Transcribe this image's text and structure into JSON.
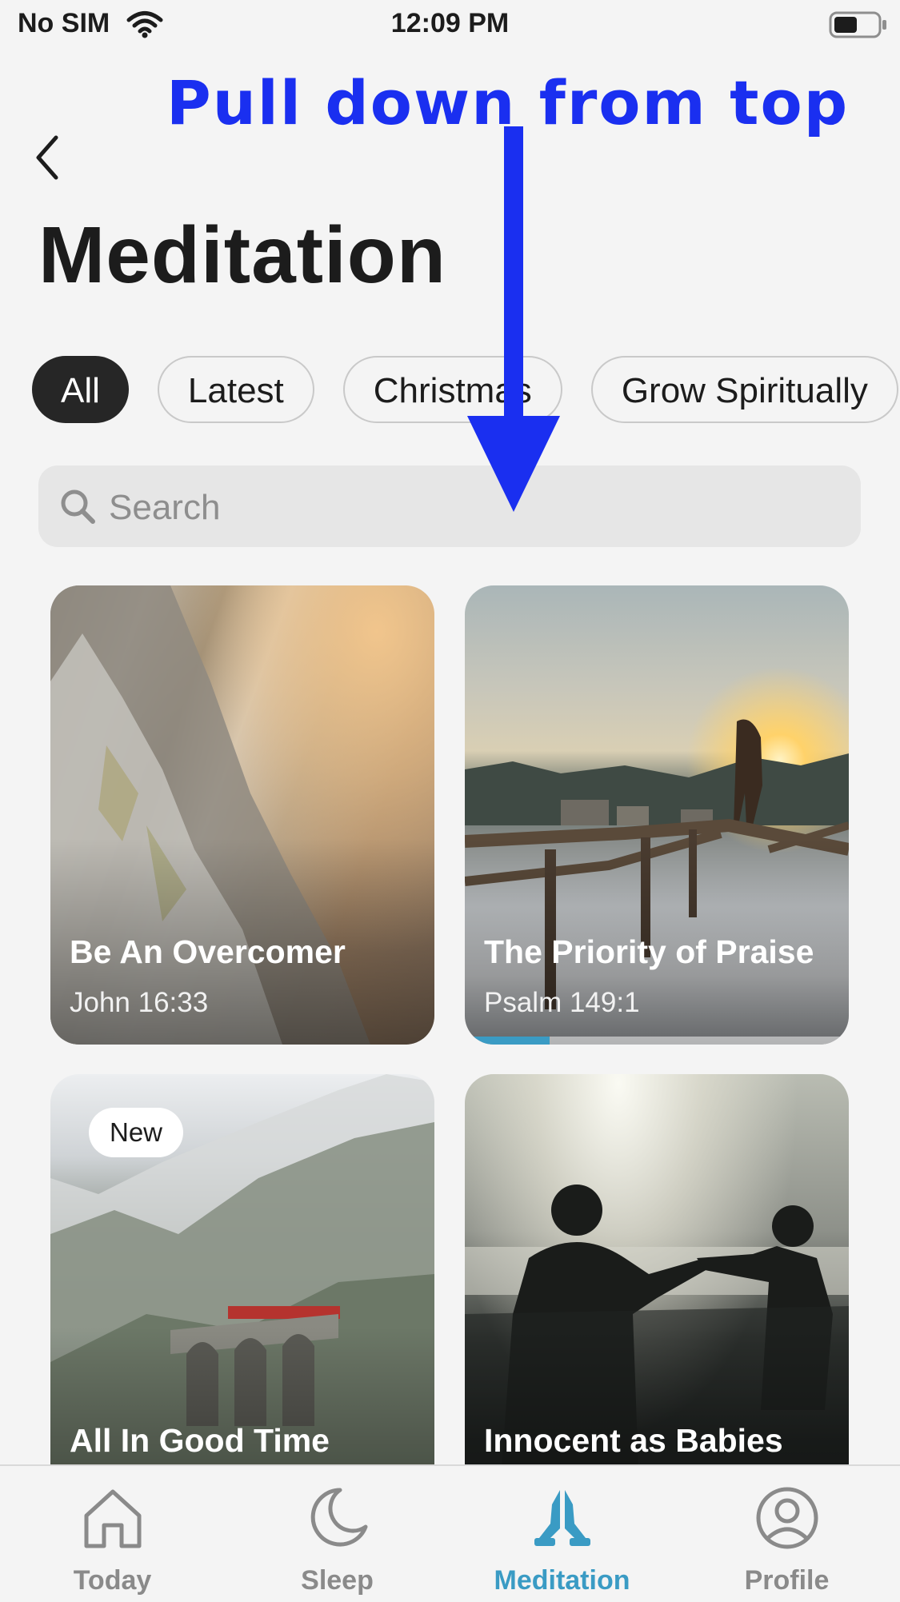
{
  "status_bar": {
    "carrier": "No SIM",
    "time": "12:09 PM"
  },
  "annotation": {
    "text": "Pull down from top",
    "color": "#1a2ff0"
  },
  "page_title": "Meditation",
  "filters": {
    "chips": [
      {
        "label": "All",
        "active": true
      },
      {
        "label": "Latest",
        "active": false
      },
      {
        "label": "Christmas",
        "active": false
      },
      {
        "label": "Grow Spiritually",
        "active": false
      }
    ]
  },
  "search": {
    "placeholder": "Search"
  },
  "cards": [
    {
      "title": "Be An Overcomer",
      "subtitle": "John 16:33"
    },
    {
      "title": "The Priority of Praise",
      "subtitle": "Psalm 149:1",
      "progress": 0.22
    },
    {
      "title": "All In Good Time",
      "badge": "New"
    },
    {
      "title": "Innocent as Babies"
    }
  ],
  "tab_bar": {
    "accent": "#3a9bc4",
    "tabs": [
      {
        "label": "Today",
        "icon": "home-icon"
      },
      {
        "label": "Sleep",
        "icon": "moon-icon"
      },
      {
        "label": "Meditation",
        "icon": "praying-hands-icon",
        "active": true
      },
      {
        "label": "Profile",
        "icon": "profile-icon"
      }
    ]
  }
}
